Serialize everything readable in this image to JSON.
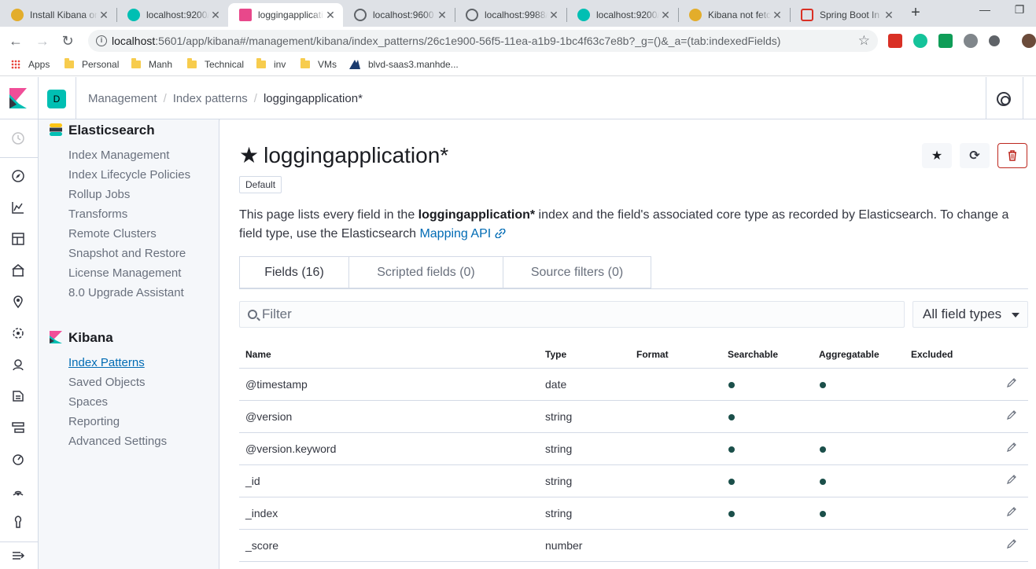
{
  "browser": {
    "tabs": [
      {
        "title": "Install Kibana on",
        "fav": "#e3ad2b",
        "active": false
      },
      {
        "title": "localhost:9200/",
        "fav": "#00bfb3",
        "active": false
      },
      {
        "title": "loggingapplicati",
        "fav": "#e8488b",
        "active": true
      },
      {
        "title": "localhost:9600",
        "fav": "#5f6368",
        "active": false
      },
      {
        "title": "localhost:9988/",
        "fav": "#5f6368",
        "active": false
      },
      {
        "title": "localhost:9200/",
        "fav": "#00bfb3",
        "active": false
      },
      {
        "title": "Kibana not fetc",
        "fav": "#e3ad2b",
        "active": false
      },
      {
        "title": "Spring Boot In",
        "fav": "#d93025",
        "active": false
      }
    ],
    "url_host": "localhost",
    "url_rest": ":5601/app/kibana#/management/kibana/index_patterns/26c1e900-56f5-11ea-a1b9-1bc4f63c7e8b?_g=()&_a=(tab:indexedFields)",
    "bookmarks": [
      {
        "label": "Apps",
        "icon": "apps-icon"
      },
      {
        "label": "Personal",
        "icon": "folder-icon"
      },
      {
        "label": "Manh",
        "icon": "folder-icon"
      },
      {
        "label": "Technical",
        "icon": "folder-icon"
      },
      {
        "label": "inv",
        "icon": "folder-icon"
      },
      {
        "label": "VMs",
        "icon": "folder-icon"
      },
      {
        "label": "blvd-saas3.manhde...",
        "icon": "site-icon"
      }
    ]
  },
  "kibana": {
    "space_initial": "D",
    "breadcrumbs": [
      "Management",
      "Index patterns",
      "loggingapplication*"
    ]
  },
  "sidebar": {
    "elasticsearch": {
      "title": "Elasticsearch",
      "items": [
        "Index Management",
        "Index Lifecycle Policies",
        "Rollup Jobs",
        "Transforms",
        "Remote Clusters",
        "Snapshot and Restore",
        "License Management",
        "8.0 Upgrade Assistant"
      ]
    },
    "kibana": {
      "title": "Kibana",
      "items": [
        "Index Patterns",
        "Saved Objects",
        "Spaces",
        "Reporting",
        "Advanced Settings"
      ],
      "active_index": 0
    }
  },
  "main": {
    "title": "loggingapplication*",
    "badge": "Default",
    "desc_pre": "This page lists every field in the ",
    "desc_bold": "loggingapplication*",
    "desc_post": " index and the field's associated core type as recorded by Elasticsearch. To change a field type, use the Elasticsearch ",
    "desc_link": "Mapping API",
    "tabs": [
      "Fields (16)",
      "Scripted fields (0)",
      "Source filters (0)"
    ],
    "filter_placeholder": "Filter",
    "type_select": "All field types",
    "columns": [
      "Name",
      "Type",
      "Format",
      "Searchable",
      "Aggregatable",
      "Excluded"
    ],
    "rows": [
      {
        "name": "@timestamp",
        "type": "date",
        "searchable": true,
        "aggregatable": true
      },
      {
        "name": "@version",
        "type": "string",
        "searchable": true,
        "aggregatable": false
      },
      {
        "name": "@version.keyword",
        "type": "string",
        "searchable": true,
        "aggregatable": true
      },
      {
        "name": "_id",
        "type": "string",
        "searchable": true,
        "aggregatable": true
      },
      {
        "name": "_index",
        "type": "string",
        "searchable": true,
        "aggregatable": true
      },
      {
        "name": "_score",
        "type": "number",
        "searchable": false,
        "aggregatable": false
      }
    ]
  }
}
